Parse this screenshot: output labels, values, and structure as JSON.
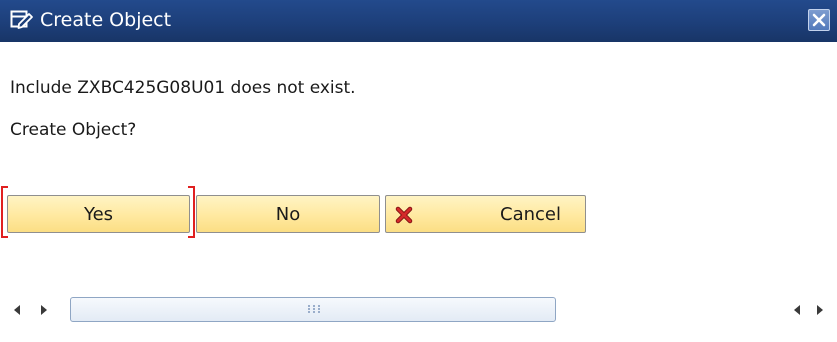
{
  "window": {
    "title": "Create Object",
    "icon": "edit-document-icon",
    "close_icon": "close-icon"
  },
  "messages": [
    "Include ZXBC425G08U01 does not exist.",
    "Create Object?"
  ],
  "buttons": {
    "yes": "Yes",
    "no": "No",
    "cancel": "Cancel",
    "cancel_icon": "red-x-icon"
  },
  "scrollbar": {
    "left_icon": "scroll-left-icon",
    "right_icon": "scroll-right-icon",
    "grip_icon": "scroll-grip-icon"
  },
  "colors": {
    "titlebar": "#1d3f7a",
    "button_face": "#ffe9a0",
    "focus_bracket": "#e02020",
    "cancel_x": "#d42a2a"
  }
}
